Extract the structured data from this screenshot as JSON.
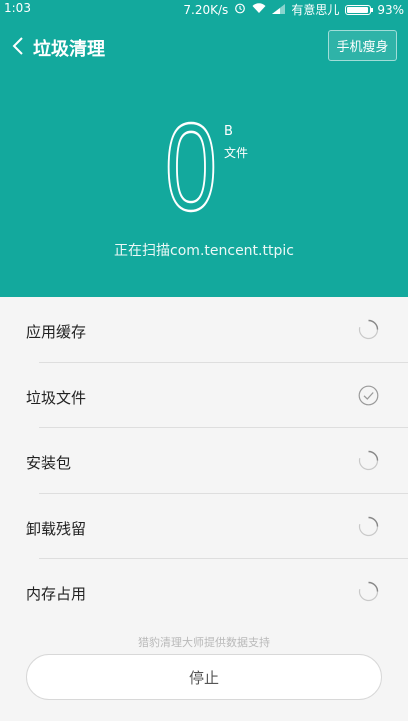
{
  "status_bar": {
    "time": "1:03",
    "speed": "7.20K/s",
    "carrier": "有意思儿",
    "battery": "93%"
  },
  "header": {
    "title": "垃圾清理",
    "slim_button": "手机瘦身"
  },
  "scan": {
    "value": "0",
    "unit": "B",
    "unit_sub": "文件",
    "status_text": "正在扫描com.tencent.ttpic"
  },
  "items": [
    {
      "label": "应用缓存",
      "status": "scanning"
    },
    {
      "label": "垃圾文件",
      "status": "done"
    },
    {
      "label": "安装包",
      "status": "scanning"
    },
    {
      "label": "卸载残留",
      "status": "scanning"
    },
    {
      "label": "内存占用",
      "status": "scanning"
    }
  ],
  "footer": {
    "note": "猎豹清理大师提供数据支持",
    "stop_button": "停止"
  },
  "colors": {
    "accent": "#13a99d"
  }
}
